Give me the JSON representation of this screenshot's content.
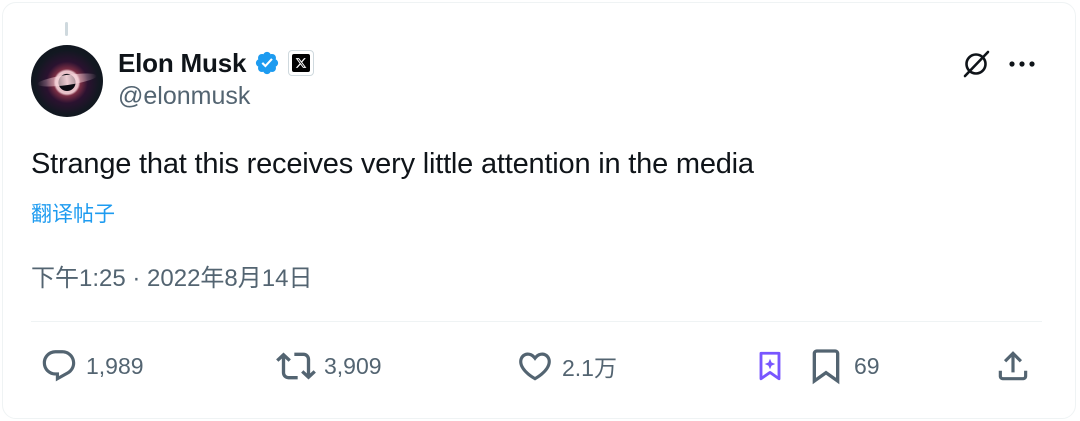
{
  "author": {
    "name": "Elon Musk",
    "handle": "@elonmusk"
  },
  "tweet": {
    "text": "Strange that this receives very little attention in the media",
    "translate_label": "翻译帖子",
    "timestamp": "下午1:25 · 2022年8月14日"
  },
  "stats": {
    "replies": "1,989",
    "reposts": "3,909",
    "likes": "2.1万",
    "bookmarks": "69"
  },
  "icons": {
    "verified": "verified-badge-icon",
    "affiliation": "x-logo-icon",
    "grok": "grok-icon",
    "more": "more-dots-icon",
    "reply": "reply-icon",
    "repost": "repost-icon",
    "like": "heart-icon",
    "grok_bookmark": "grok-bookmark-icon",
    "bookmark": "bookmark-icon",
    "share": "share-icon"
  },
  "colors": {
    "accent": "#1d9bf0",
    "muted": "#536471",
    "text": "#0f1419",
    "grok_purple": "#7856ff"
  }
}
